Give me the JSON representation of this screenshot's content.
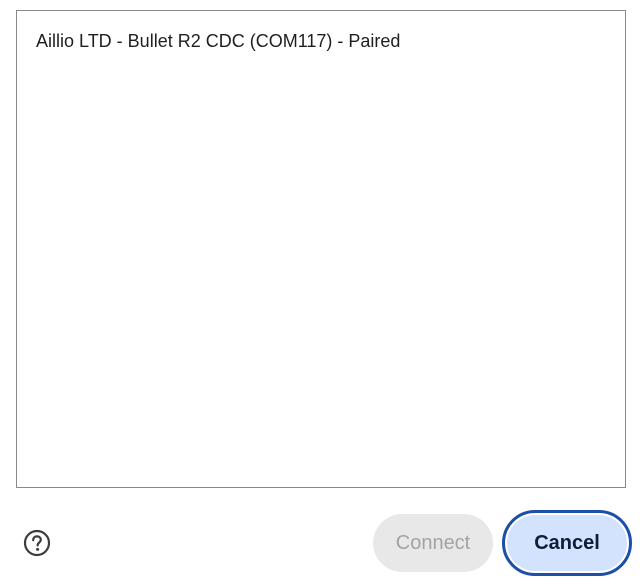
{
  "device_list": {
    "items": [
      {
        "label": "Aillio LTD - Bullet R2 CDC (COM117) - Paired"
      }
    ]
  },
  "footer": {
    "help_icon": "question-circle-icon",
    "connect_label": "Connect",
    "cancel_label": "Cancel",
    "connect_enabled": false
  },
  "colors": {
    "primary_fill": "#d3e3fd",
    "primary_border": "#1c4fa8",
    "disabled_fill": "#e8e8e8",
    "disabled_text": "#a3a3a3"
  }
}
